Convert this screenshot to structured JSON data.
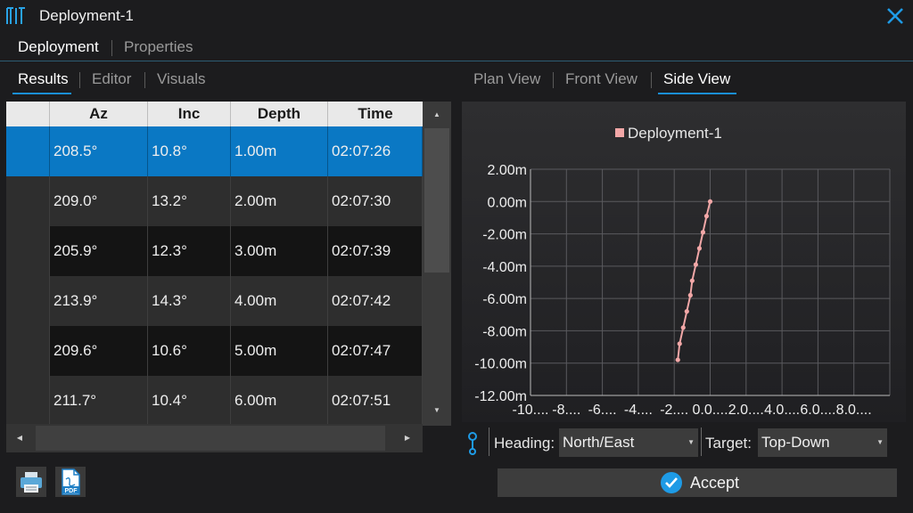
{
  "window": {
    "title": "Deployment-1",
    "close_icon": "close-icon",
    "logo_icon": "app-logo-icon"
  },
  "top_tabs": [
    {
      "label": "Deployment"
    },
    {
      "label": "Properties"
    }
  ],
  "left_tabs": [
    {
      "label": "Results"
    },
    {
      "label": "Editor"
    },
    {
      "label": "Visuals"
    }
  ],
  "view_tabs": [
    {
      "label": "Plan View"
    },
    {
      "label": "Front View"
    },
    {
      "label": "Side View"
    }
  ],
  "table": {
    "columns": [
      "Az",
      "Inc",
      "Depth",
      "Time"
    ],
    "rows": [
      {
        "az": "208.5°",
        "inc": "10.8°",
        "depth": "1.00m",
        "time": "02:07:26"
      },
      {
        "az": "209.0°",
        "inc": "13.2°",
        "depth": "2.00m",
        "time": "02:07:30"
      },
      {
        "az": "205.9°",
        "inc": "12.3°",
        "depth": "3.00m",
        "time": "02:07:39"
      },
      {
        "az": "213.9°",
        "inc": "14.3°",
        "depth": "4.00m",
        "time": "02:07:42"
      },
      {
        "az": "209.6°",
        "inc": "10.6°",
        "depth": "5.00m",
        "time": "02:07:47"
      },
      {
        "az": "211.7°",
        "inc": "10.4°",
        "depth": "6.00m",
        "time": "02:07:51"
      }
    ],
    "selected_row": 0
  },
  "chart_data": {
    "type": "line",
    "legend_position": "top",
    "grid": true,
    "series": [
      {
        "name": "Deployment-1",
        "color": "#f2a7a7",
        "x": [
          0.0,
          -0.2,
          -0.4,
          -0.6,
          -0.8,
          -1.0,
          -1.1,
          -1.3,
          -1.5,
          -1.7,
          -1.8
        ],
        "y": [
          0.0,
          -0.9,
          -1.9,
          -2.9,
          -3.9,
          -4.9,
          -5.8,
          -6.8,
          -7.8,
          -8.8,
          -9.8
        ]
      }
    ],
    "xlim": [
      -10,
      10
    ],
    "ylim": [
      -12,
      2
    ],
    "y_ticks": [
      "2.00m",
      "0.00m",
      "-2.00m",
      "-4.00m",
      "-6.00m",
      "-8.00m",
      "-10.00m",
      "-12.00m"
    ],
    "x_ticks": [
      "-10....",
      "-8....",
      "-6....",
      "-4....",
      "-2....",
      "0.0....",
      "2.0....",
      "4.0....",
      "6.0....",
      "8.0...."
    ]
  },
  "controls": {
    "heading_label": "Heading:",
    "heading_value": "North/East",
    "target_label": "Target:",
    "target_value": "Top-Down",
    "link_icon": "link-icon",
    "accept_label": "Accept",
    "print_icon": "print-icon",
    "pdf_icon": "pdf-icon"
  }
}
